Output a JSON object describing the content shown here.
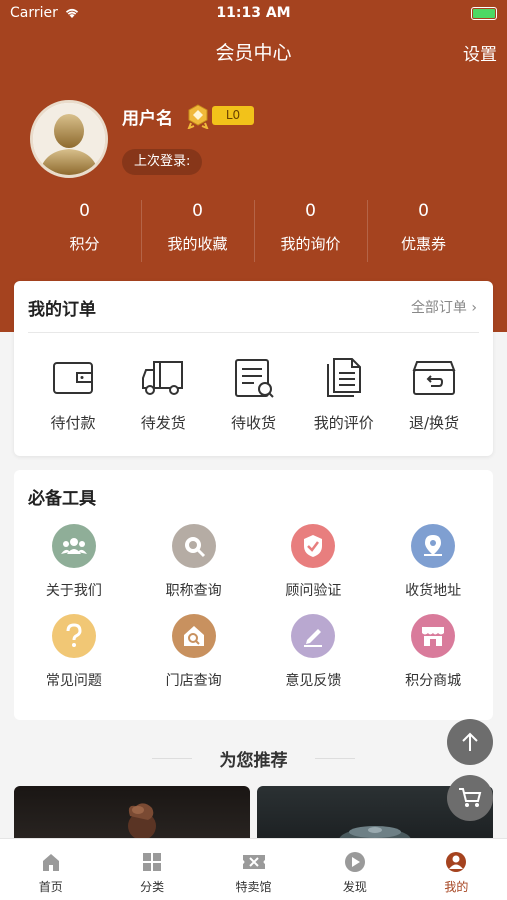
{
  "status_bar": {
    "carrier": "Carrier",
    "time": "11:13 AM"
  },
  "nav": {
    "title": "会员中心",
    "settings": "设置"
  },
  "profile": {
    "username": "用户名",
    "level": "L0",
    "last_login": "上次登录:"
  },
  "stats": [
    {
      "value": "0",
      "label": "积分"
    },
    {
      "value": "0",
      "label": "我的收藏"
    },
    {
      "value": "0",
      "label": "我的询价"
    },
    {
      "value": "0",
      "label": "优惠券"
    }
  ],
  "orders": {
    "title": "我的订单",
    "all_orders": "全部订单 ›",
    "items": [
      {
        "label": "待付款",
        "icon": "wallet-icon"
      },
      {
        "label": "待发货",
        "icon": "truck-icon"
      },
      {
        "label": "待收货",
        "icon": "receipt-icon"
      },
      {
        "label": "我的评价",
        "icon": "document-icon"
      },
      {
        "label": "退/换货",
        "icon": "return-box-icon"
      }
    ]
  },
  "tools": {
    "title": "必备工具",
    "items": [
      {
        "label": "关于我们",
        "icon": "group-icon",
        "color": "#8fae98"
      },
      {
        "label": "职称查询",
        "icon": "search-icon",
        "color": "#b5aca4"
      },
      {
        "label": "顾问验证",
        "icon": "shield-check-icon",
        "color": "#e87e7e"
      },
      {
        "label": "收货地址",
        "icon": "location-icon",
        "color": "#7f9fd1"
      },
      {
        "label": "常见问题",
        "icon": "question-icon",
        "color": "#f1c775"
      },
      {
        "label": "门店查询",
        "icon": "store-search-icon",
        "color": "#c8915f"
      },
      {
        "label": "意见反馈",
        "icon": "pencil-icon",
        "color": "#b9a8d0"
      },
      {
        "label": "积分商城",
        "icon": "shop-icon",
        "color": "#d97b9b"
      }
    ]
  },
  "recommend": {
    "title": "为您推荐"
  },
  "tabs": [
    {
      "label": "首页",
      "icon": "home-icon",
      "active": false
    },
    {
      "label": "分类",
      "icon": "category-icon",
      "active": false
    },
    {
      "label": "特卖馆",
      "icon": "sale-icon",
      "active": false
    },
    {
      "label": "发现",
      "icon": "play-icon",
      "active": false
    },
    {
      "label": "我的",
      "icon": "user-icon",
      "active": true
    }
  ],
  "colors": {
    "brand": "#a5431f",
    "level_badge": "#f2c21a"
  }
}
